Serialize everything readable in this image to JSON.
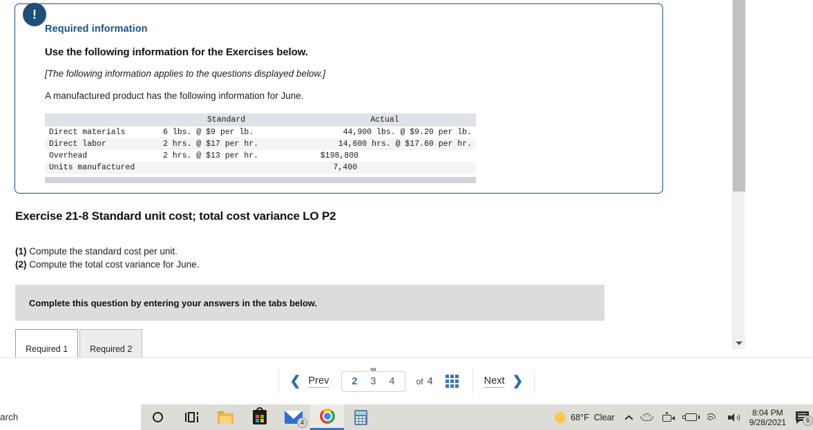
{
  "card": {
    "badge_icon": "exclamation-icon",
    "badge_text": "!",
    "title": "Required information",
    "subtitle": "Use the following information for the Exercises below.",
    "note": "[The following information applies to the questions displayed below.]",
    "lead": "A manufactured product has the following information for June.",
    "table": {
      "columns": [
        "",
        "Standard",
        "Actual"
      ],
      "rows": [
        {
          "label": "Direct materials",
          "standard": "6 lbs. @ $9 per lb.",
          "actual": "44,900 lbs. @ $9.20 per lb."
        },
        {
          "label": "Direct labor",
          "standard": "2 hrs. @ $17 per hr.",
          "actual": "14,600 hrs. @ $17.60 per hr."
        },
        {
          "label": "Overhead",
          "standard": "2 hrs. @ $13 per hr.",
          "actual": "$198,800"
        },
        {
          "label": "Units manufactured",
          "standard": "",
          "actual": "7,400"
        }
      ]
    }
  },
  "exercise": {
    "title": "Exercise 21-8 Standard unit cost; total cost variance LO P2",
    "questions": [
      {
        "num": "(1)",
        "text": "Compute the standard cost per unit."
      },
      {
        "num": "(2)",
        "text": "Compute the total cost variance for June."
      }
    ],
    "instruction": "Complete this question by entering your answers in the tabs below.",
    "tabs": [
      {
        "label": "Required 1",
        "active": true
      },
      {
        "label": "Required 2",
        "active": false
      }
    ]
  },
  "pager": {
    "prev_label": "Prev",
    "next_label": "Next",
    "page_numbers": [
      "2",
      "3",
      "4"
    ],
    "current_page": "2",
    "of_label": "of",
    "total_pages": "4",
    "link_glyph": "∞",
    "grid_icon": "grid-view-icon",
    "prev_icon": "chevron-left-icon",
    "next_icon": "chevron-right-icon"
  },
  "scrollbar": {
    "down_icon": "scroll-down-arrow-icon"
  },
  "taskbar": {
    "search_text": "arch",
    "items": [
      {
        "name": "cortana-icon"
      },
      {
        "name": "task-view-icon"
      },
      {
        "name": "file-explorer-icon"
      },
      {
        "name": "microsoft-store-icon"
      },
      {
        "name": "mail-icon",
        "badge": "4"
      },
      {
        "name": "chrome-icon",
        "active": true
      },
      {
        "name": "calculator-icon"
      }
    ],
    "tray": {
      "weather_icon": "moon-icon",
      "temperature": "68°F",
      "condition": "Clear",
      "icons": [
        "chevron-up-icon",
        "onedrive-cloud-icon",
        "camera-icon",
        "battery-icon",
        "wifi-icon",
        "volume-icon"
      ],
      "time": "8:04 PM",
      "date": "9/28/2021",
      "notification_icon": "notifications-icon",
      "notification_badge": "6"
    }
  },
  "colors": {
    "card_border": "#1b4f82",
    "badge_bg": "#1f4e79",
    "heading_blue": "#17528f",
    "accent_blue": "#2b6cb8",
    "instruction_bar": "#dcdcdc",
    "table_header": "#dfe3e8",
    "taskbar_bg": "#dedcd6"
  }
}
